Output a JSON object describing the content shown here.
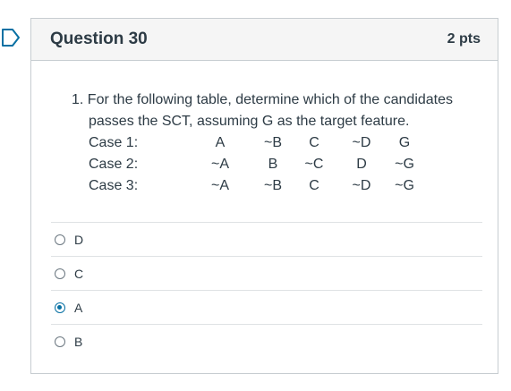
{
  "question": {
    "title": "Question 30",
    "points": "2 pts",
    "text_line1": "1. For the following table, determine which of the candidates",
    "text_line2": "passes the SCT, assuming G as the target feature."
  },
  "table": {
    "rows": [
      {
        "label": "Case 1:",
        "cells": [
          "A",
          "~B",
          "C",
          "~D",
          "G"
        ]
      },
      {
        "label": "Case 2:",
        "cells": [
          "~A",
          "B",
          "~C",
          "D",
          "~G"
        ]
      },
      {
        "label": "Case 3:",
        "cells": [
          "~A",
          "~B",
          "C",
          "~D",
          "~G"
        ]
      }
    ]
  },
  "answers": [
    {
      "label": "D",
      "selected": false
    },
    {
      "label": "C",
      "selected": false
    },
    {
      "label": "A",
      "selected": true
    },
    {
      "label": "B",
      "selected": false
    }
  ],
  "colors": {
    "accent": "#0770a3",
    "text": "#2d3b45",
    "border": "#c7cdd1",
    "header_bg": "#f5f5f5"
  },
  "icons": {
    "flag": "bookmark-flag-icon"
  }
}
